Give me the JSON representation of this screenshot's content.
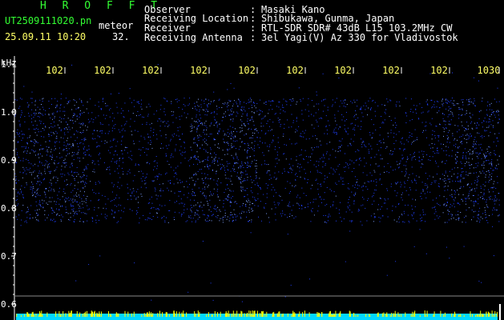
{
  "header": {
    "app_title": "H R O F F T",
    "filename": "UT2509111020.pn",
    "meteor_label": "meteor",
    "datetime": "25.09.11 10:20",
    "count": "32.",
    "info": [
      {
        "label": "Observer",
        "value": "Masaki Kano"
      },
      {
        "label": "Receiving Location",
        "value": "Shibukawa, Gunma, Japan"
      },
      {
        "label": "Receiver",
        "value": "RTL-SDR SDR# 43dB L15 103.2MHz CW"
      },
      {
        "label": "Receiving Antenna",
        "value": "3el Yagi(V) Az 330 for Vladivostok"
      }
    ]
  },
  "colors": {
    "noise_blue": "#2040ff",
    "bright_blue": "#7fa0ff",
    "bottom_bar": "#00d8ff",
    "bottom_marks": "#ffff00",
    "text_green": "#33ff33",
    "text_yellow": "#ffff66"
  },
  "chart_data": {
    "type": "heatmap",
    "ylabel": "kHz",
    "ytick_labels": [
      "1.1",
      "1.0",
      "0.9",
      "0.8",
      "0.7",
      "0.6"
    ],
    "yticks": [
      1.1,
      1.0,
      0.9,
      0.8,
      0.7,
      0.6
    ],
    "ylim": [
      0.6,
      1.1
    ],
    "xtick_labels": [
      "102",
      "102",
      "102",
      "102",
      "102",
      "102",
      "102",
      "102",
      "102",
      "1030"
    ],
    "band_khz": [
      0.77,
      1.03
    ],
    "bright_segments_x_fraction": [
      [
        0.03,
        0.15
      ],
      [
        0.36,
        0.5
      ],
      [
        0.88,
        1.0
      ]
    ]
  }
}
